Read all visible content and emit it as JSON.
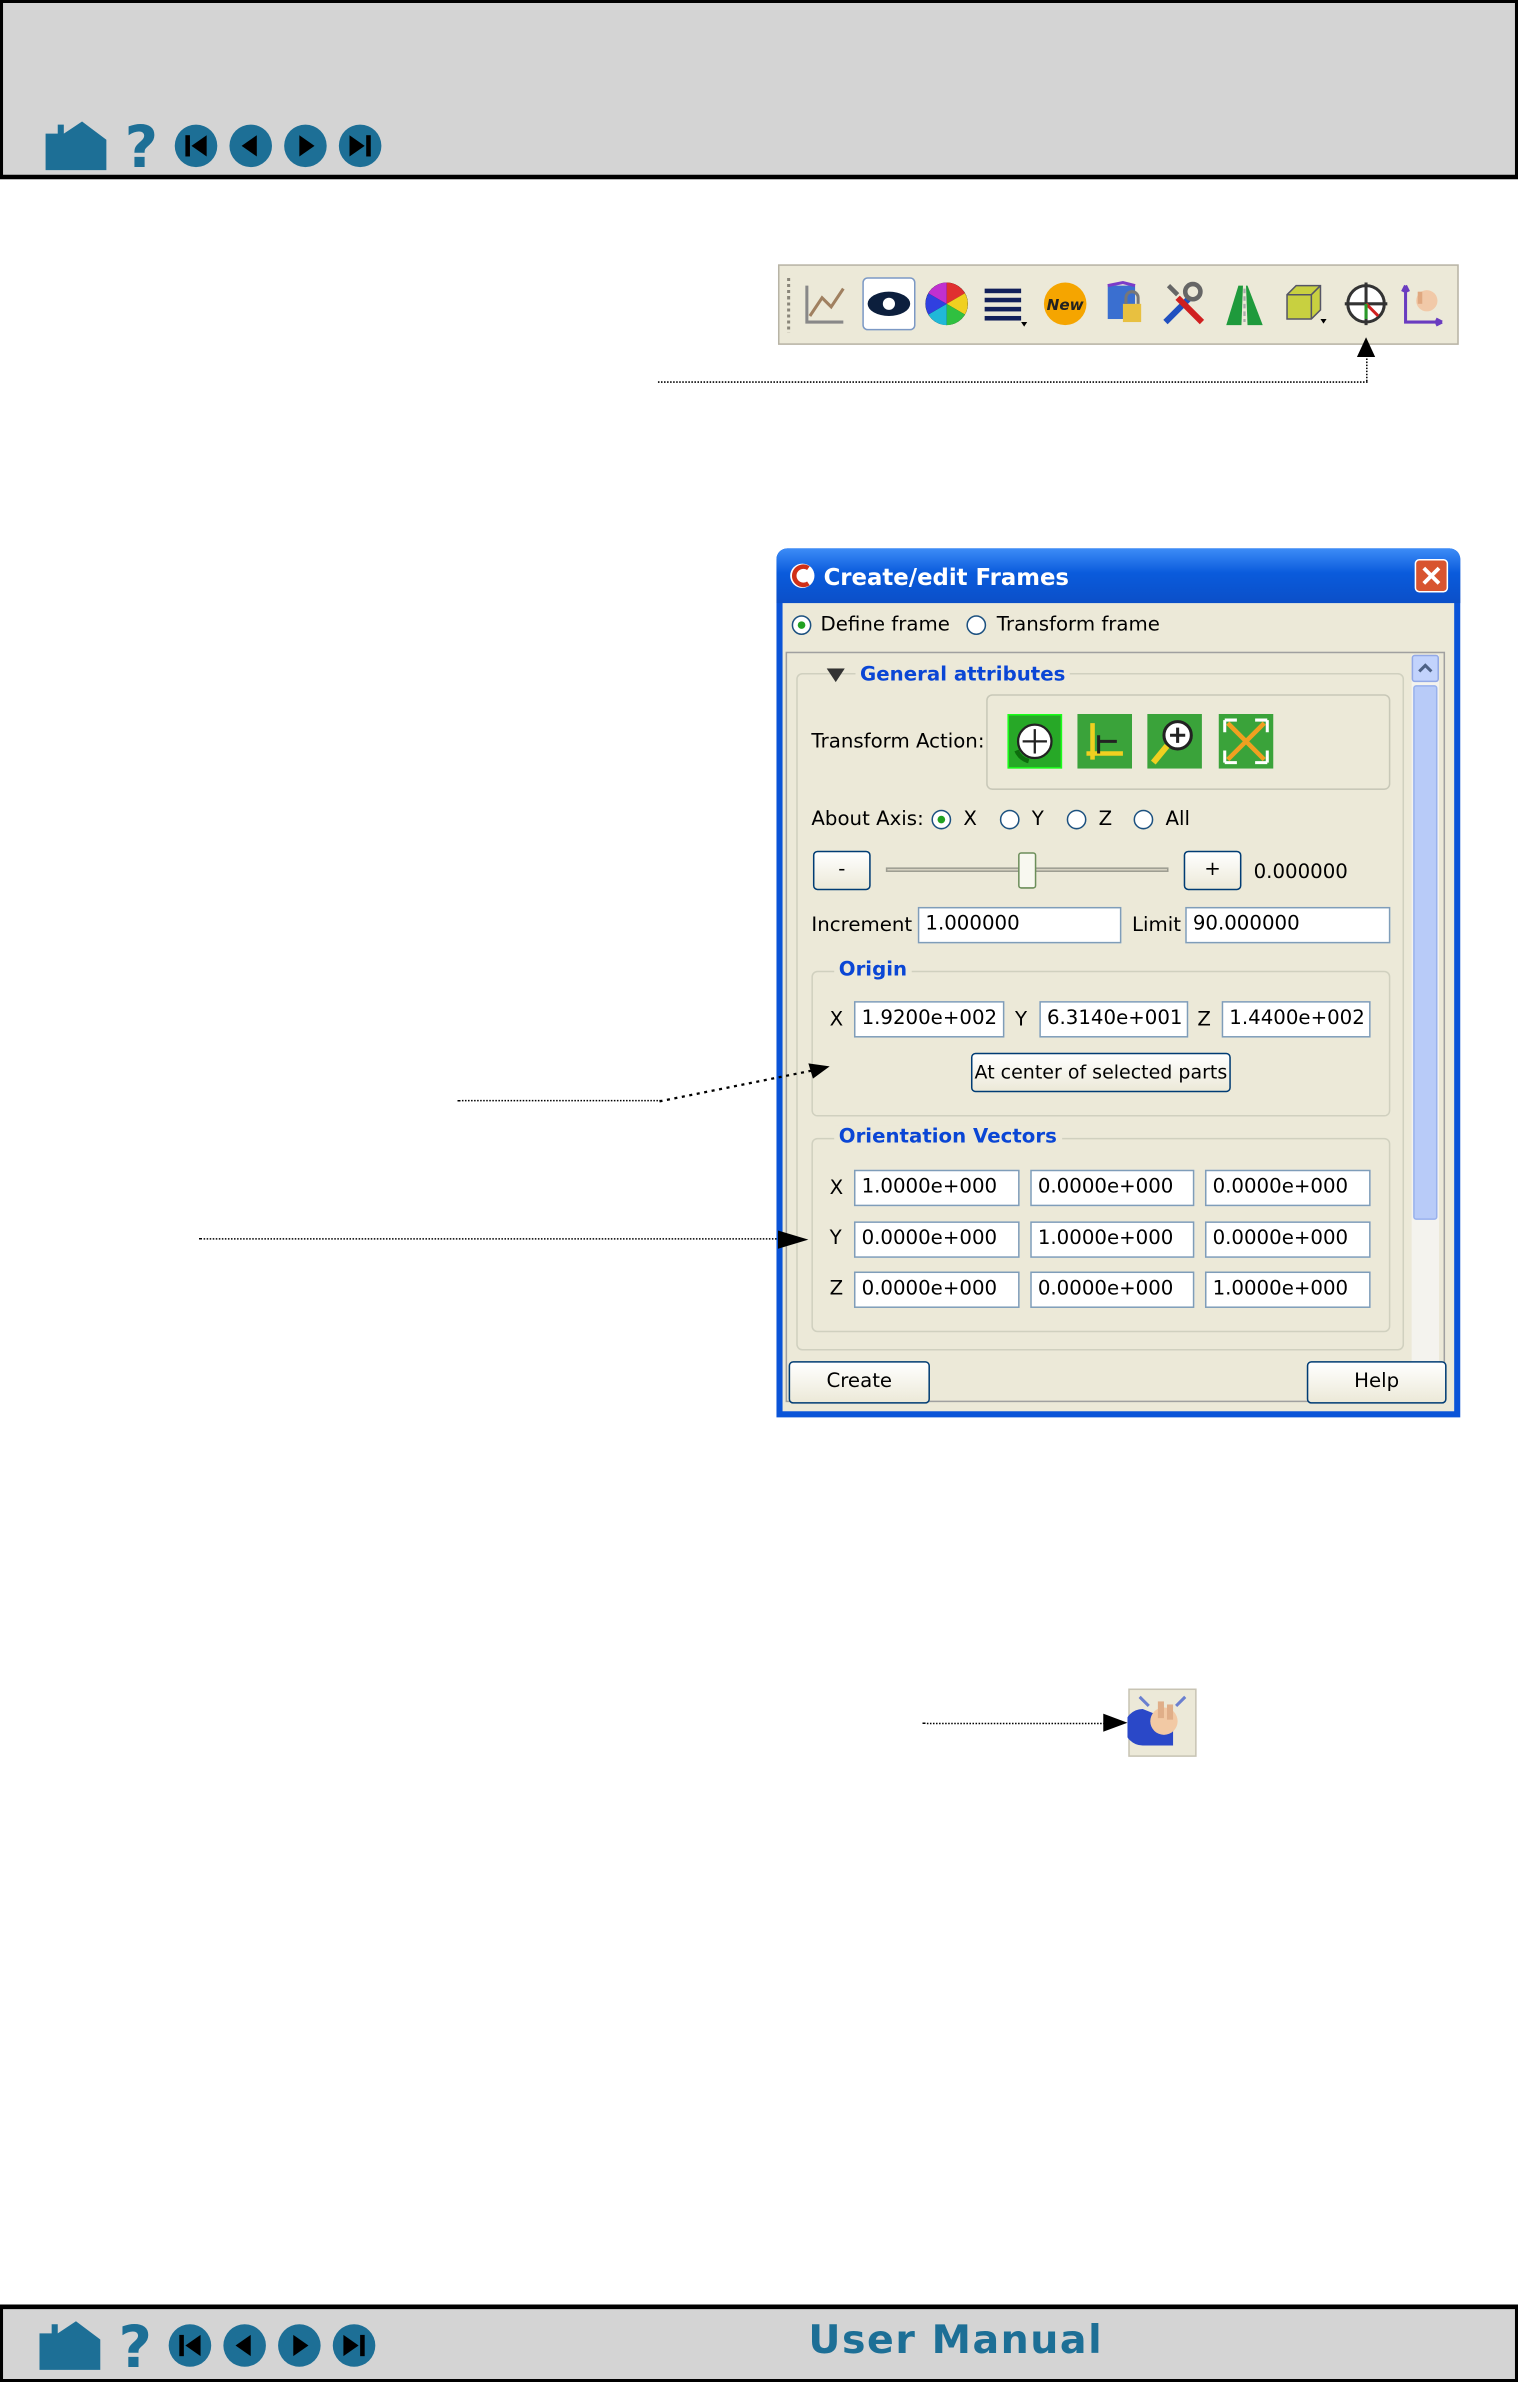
{
  "footer": {
    "manual_label": "User Manual"
  },
  "nav_icons": [
    "home-icon",
    "help-icon",
    "first-page-icon",
    "previous-page-icon",
    "next-page-icon",
    "last-page-icon"
  ],
  "dialog": {
    "title": "Create/edit Frames",
    "mode_define": "Define frame",
    "mode_transform": "Transform frame",
    "general_attributes": "General attributes",
    "transform_action_label": "Transform Action:",
    "about_axis_label": "About Axis:",
    "axis_options": [
      "X",
      "Y",
      "Z",
      "All"
    ],
    "minus_label": "-",
    "plus_label": "+",
    "slider_value": "0.000000",
    "increment_label": "Increment",
    "increment_value": "1.000000",
    "limit_label": "Limit",
    "limit_value": "90.000000",
    "origin": {
      "title": "Origin",
      "x_label": "X",
      "x_value": "1.9200e+002",
      "y_label": "Y",
      "y_value": "6.3140e+001",
      "z_label": "Z",
      "z_value": "1.4400e+002",
      "center_button": "At center of selected parts"
    },
    "orientation": {
      "title": "Orientation Vectors",
      "rows": [
        {
          "label": "X",
          "values": [
            "1.0000e+000",
            "0.0000e+000",
            "0.0000e+000"
          ]
        },
        {
          "label": "Y",
          "values": [
            "0.0000e+000",
            "1.0000e+000",
            "0.0000e+000"
          ]
        },
        {
          "label": "Z",
          "values": [
            "0.0000e+000",
            "0.0000e+000",
            "1.0000e+000"
          ]
        }
      ]
    },
    "create_button": "Create",
    "help_button": "Help"
  },
  "accent_color": "#1d6f96",
  "xp_title_blue": "#0a5bdc"
}
